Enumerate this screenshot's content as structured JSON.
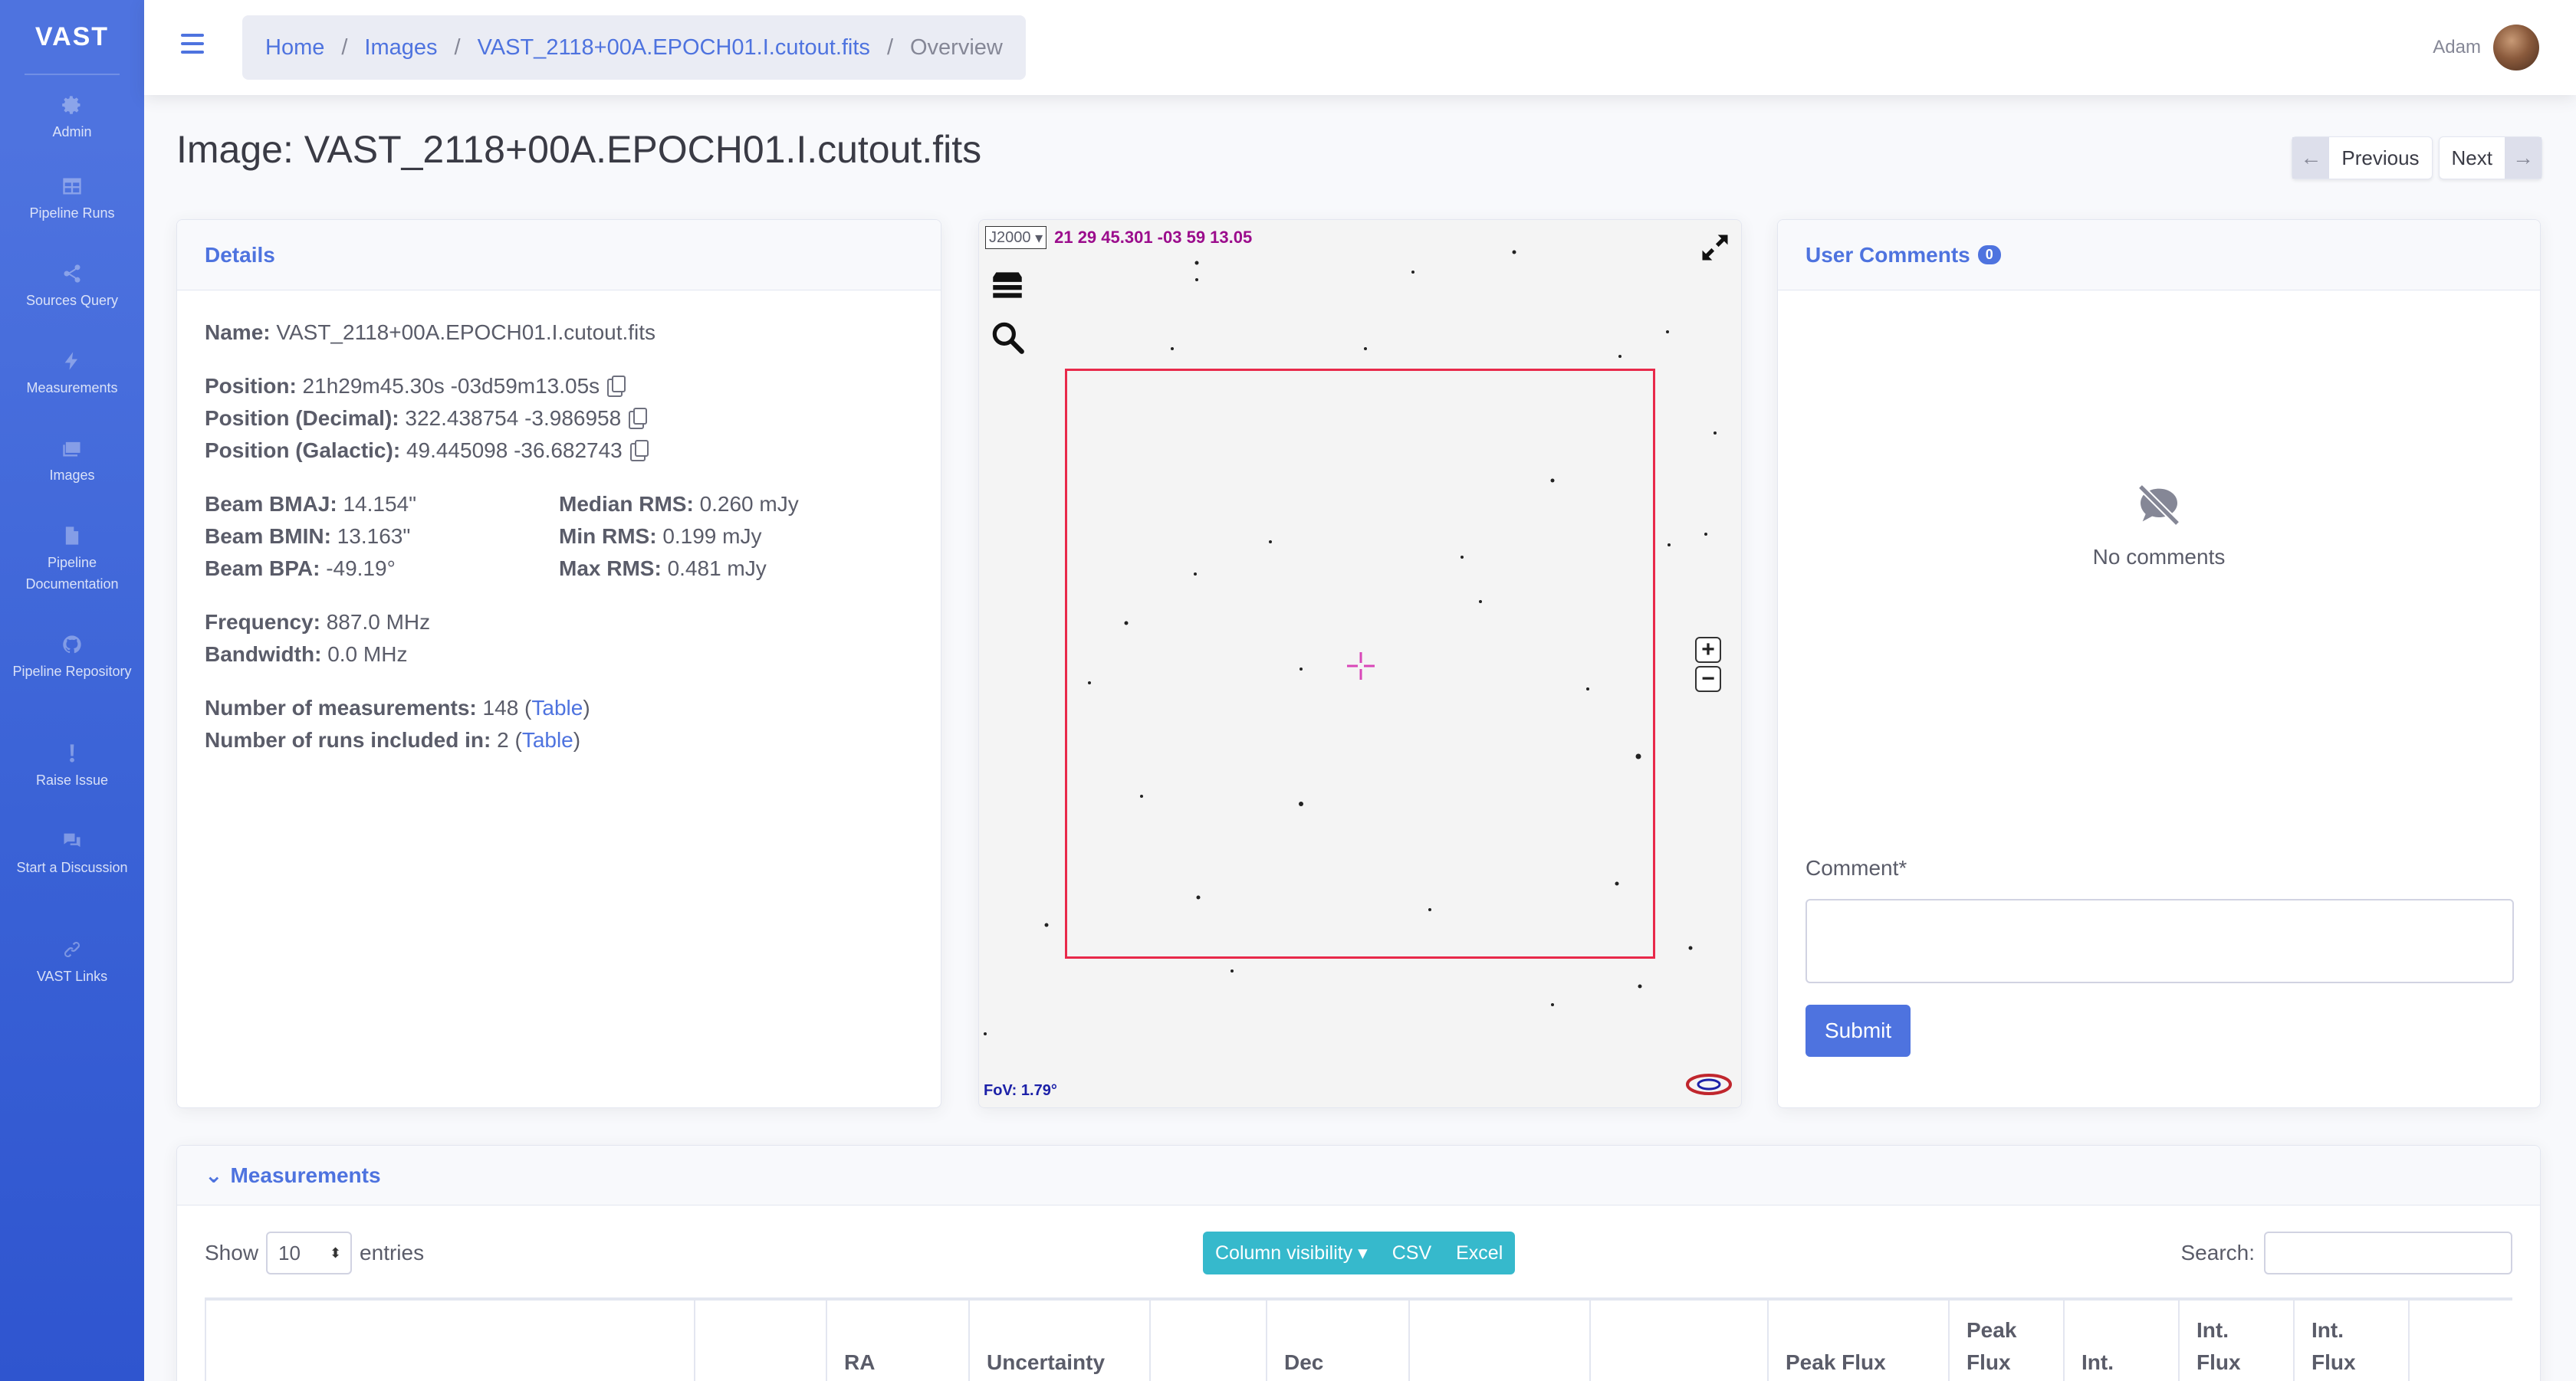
{
  "sidebar": {
    "brand": "VAST",
    "items": [
      {
        "label": "Admin",
        "icon": "gear-icon"
      },
      {
        "label": "Pipeline Runs",
        "icon": "table-icon"
      },
      {
        "label": "Sources Query",
        "icon": "share-icon"
      },
      {
        "label": "Measurements",
        "icon": "bolt-icon"
      },
      {
        "label": "Images",
        "icon": "images-icon"
      },
      {
        "label": "Pipeline Documentation",
        "icon": "file-icon"
      },
      {
        "label": "Pipeline Repository",
        "icon": "github-icon"
      },
      {
        "label": "Raise Issue",
        "icon": "exclamation-icon"
      },
      {
        "label": "Start a Discussion",
        "icon": "comments-icon"
      },
      {
        "label": "VAST Links",
        "icon": "link-icon"
      }
    ]
  },
  "topbar": {
    "breadcrumb": [
      "Home",
      "Images",
      "VAST_2118+00A.EPOCH01.I.cutout.fits",
      "Overview"
    ],
    "user_name": "Adam"
  },
  "page": {
    "title": "Image: VAST_2118+00A.EPOCH01.I.cutout.fits",
    "previous": "Previous",
    "next": "Next"
  },
  "details": {
    "header": "Details",
    "name_label": "Name:",
    "name": "VAST_2118+00A.EPOCH01.I.cutout.fits",
    "position_label": "Position:",
    "position": "21h29m45.30s -03d59m13.05s",
    "position_decimal_label": "Position (Decimal):",
    "position_decimal": "322.438754 -3.986958",
    "position_galactic_label": "Position (Galactic):",
    "position_galactic": "49.445098 -36.682743",
    "beam_bmaj_label": "Beam BMAJ:",
    "beam_bmaj": "14.154\"",
    "beam_bmin_label": "Beam BMIN:",
    "beam_bmin": "13.163\"",
    "beam_bpa_label": "Beam BPA:",
    "beam_bpa": "-49.19°",
    "median_rms_label": "Median RMS:",
    "median_rms": "0.260 mJy",
    "min_rms_label": "Min RMS:",
    "min_rms": "0.199 mJy",
    "max_rms_label": "Max RMS:",
    "max_rms": "0.481 mJy",
    "frequency_label": "Frequency:",
    "frequency": "887.0 MHz",
    "bandwidth_label": "Bandwidth:",
    "bandwidth": "0.0 MHz",
    "num_meas_label": "Number of measurements:",
    "num_meas": "148",
    "num_runs_label": "Number of runs included in:",
    "num_runs": "2",
    "table_link": "Table"
  },
  "viewer": {
    "frame": "J2000",
    "coords": "21 29 45.301 -03 59 13.05",
    "fov": "FoV: 1.79°"
  },
  "comments": {
    "header": "User Comments",
    "count": "0",
    "empty": "No comments",
    "comment_label": "Comment*",
    "submit": "Submit"
  },
  "measurements": {
    "header": "Measurements",
    "show": "Show",
    "entries_value": "10",
    "entries": "entries",
    "buttons": [
      "Column visibility ▾",
      "CSV",
      "Excel"
    ],
    "search_label": "Search:",
    "columns": [
      "",
      "",
      "RA",
      "Uncertainty",
      "",
      "Dec",
      "",
      "",
      "Peak Flux",
      "Peak Flux",
      "Int.",
      "Int. Flux",
      "Int. Flux",
      ""
    ]
  },
  "colors": {
    "primary": "#4e73df",
    "info": "#36b9cc",
    "reticle": "#e8294a",
    "coord": "#9b0c8c"
  }
}
